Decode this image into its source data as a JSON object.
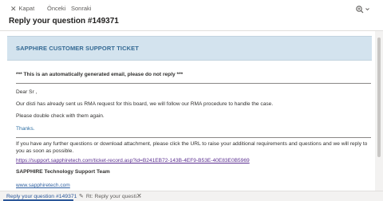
{
  "toolbar": {
    "close_label": "Kapat",
    "prev_label": "Önceki",
    "next_label": "Sonraki"
  },
  "subject": "Reply your question #149371",
  "email": {
    "banner_title": "SAPPHIRE CUSTOMER SUPPORT TICKET",
    "auto_notice": "*** This is an automatically generated email, please do not reply ***",
    "greeting": "Dear Sr ,",
    "body_line1": "Our disti has already sent us RMA request for this board, we will follow our RMA procedure to handle the case.",
    "body_line2": "Please double check with them again.",
    "thanks": "Thanks.",
    "footer_text": "If you have any further questions or download attachment, please click the URL to raise your additional requirements and questions and we will reply to you as soon as possible.",
    "ticket_url": "https://support.sapphiretech.com/ticket-record.asp?id=B241EB72-143B-4EF9-B53E-40E83E0B5969",
    "signature": "SAPPHIRE Technology Support Team",
    "website": "www.sapphiretech.com"
  },
  "tabs": [
    {
      "label": "Reply your question #149371"
    },
    {
      "label": "Rt: Reply your questi..."
    }
  ],
  "colors": {
    "banner_bg": "#d3e3ee",
    "banner_text": "#356a94",
    "accent": "#2b579a",
    "link_visited": "#5b2f91"
  }
}
